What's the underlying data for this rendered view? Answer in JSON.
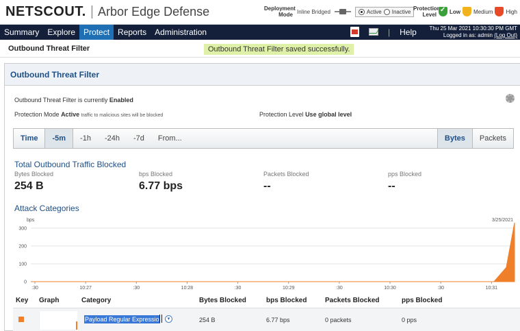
{
  "header": {
    "logo": "NETSCOUT.",
    "product": "Arbor Edge Defense",
    "deployment": {
      "label": "Deployment Mode",
      "mode": "Inline Bridged",
      "options": [
        "Active",
        "Inactive"
      ],
      "selected": "Active"
    },
    "protection": {
      "label": "Protection Level",
      "levels": [
        "Low",
        "Medium",
        "High"
      ],
      "selected": "Low"
    }
  },
  "nav": {
    "items": [
      "Summary",
      "Explore",
      "Protect",
      "Reports",
      "Administration"
    ],
    "active": "Protect",
    "sep": "|",
    "help": "Help",
    "datetime": "Thu 25 Mar 2021 10:30:30 PM GMT",
    "logged_in": "Logged in as: admin",
    "logout": "(Log Out)"
  },
  "titlebar": {
    "title": "Outbound Threat Filter",
    "message": "Outbound Threat Filter saved successfully."
  },
  "panel": {
    "title": "Outbound Threat Filter",
    "status_prefix": "Outbound Threat Filter is currently",
    "status_value": "Enabled",
    "mode_label": "Protection Mode",
    "mode_value": "Active",
    "mode_note": "traffic to malicious sites will be blocked",
    "level_label": "Protection Level",
    "level_value": "Use global level"
  },
  "timebar": {
    "label": "Time",
    "items": [
      "-5m",
      "-1h",
      "-24h",
      "-7d",
      "From..."
    ],
    "active": "-5m",
    "units": [
      "Bytes",
      "Packets"
    ],
    "active_unit": "Bytes"
  },
  "totals": {
    "title": "Total Outbound Traffic Blocked",
    "stats": [
      {
        "label": "Bytes Blocked",
        "value": "254 B"
      },
      {
        "label": "bps Blocked",
        "value": "6.77 bps"
      },
      {
        "label": "Packets Blocked",
        "value": "--"
      },
      {
        "label": "pps Blocked",
        "value": "--"
      }
    ]
  },
  "attack": {
    "title": "Attack Categories"
  },
  "chart_data": {
    "type": "area",
    "ylabel": "bps",
    "ylim": [
      0,
      330
    ],
    "yticks": [
      0,
      100,
      200,
      300
    ],
    "xticks": [
      ":30",
      "10:27",
      ":30",
      "10:28",
      ":30",
      "10:29",
      ":30",
      "10:30",
      ":30",
      "10:31"
    ],
    "date_label": "3/25/2021",
    "series": [
      {
        "name": "Payload Regular Expression",
        "color": "#f07f2a",
        "x": [
          ":30",
          "10:27",
          ":30",
          "10:28",
          ":30",
          "10:29",
          ":30",
          "10:30",
          ":30",
          "10:31",
          "end-2",
          "end-1",
          "end"
        ],
        "values": [
          0,
          0,
          0,
          0,
          0,
          0,
          0,
          0,
          0,
          0,
          0,
          80,
          330
        ]
      }
    ],
    "grid": true
  },
  "table": {
    "headers": [
      "Key",
      "Graph",
      "Category",
      "Bytes Blocked",
      "bps Blocked",
      "Packets Blocked",
      "pps Blocked"
    ],
    "rows": [
      {
        "category": "Payload Regular Expressio",
        "bytes": "254 B",
        "bps": "6.77 bps",
        "packets": "0 packets",
        "pps": "0 pps"
      }
    ]
  }
}
